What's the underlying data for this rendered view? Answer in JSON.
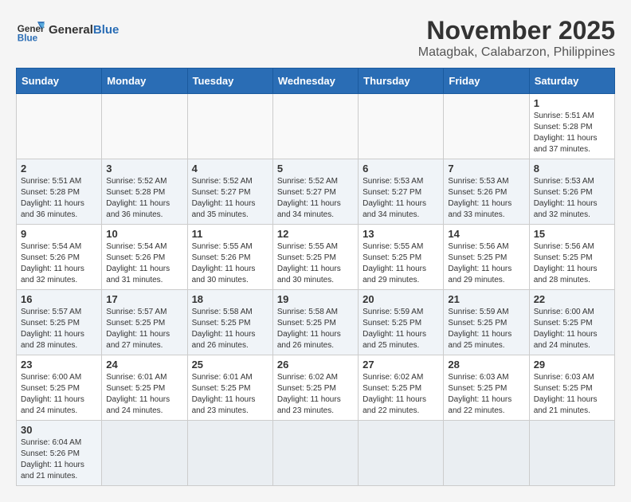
{
  "header": {
    "logo_general": "General",
    "logo_blue": "Blue",
    "month_title": "November 2025",
    "location": "Matagbak, Calabarzon, Philippines"
  },
  "days_of_week": [
    "Sunday",
    "Monday",
    "Tuesday",
    "Wednesday",
    "Thursday",
    "Friday",
    "Saturday"
  ],
  "weeks": [
    [
      {
        "day": "",
        "info": ""
      },
      {
        "day": "",
        "info": ""
      },
      {
        "day": "",
        "info": ""
      },
      {
        "day": "",
        "info": ""
      },
      {
        "day": "",
        "info": ""
      },
      {
        "day": "",
        "info": ""
      },
      {
        "day": "1",
        "info": "Sunrise: 5:51 AM\nSunset: 5:28 PM\nDaylight: 11 hours\nand 37 minutes."
      }
    ],
    [
      {
        "day": "2",
        "info": "Sunrise: 5:51 AM\nSunset: 5:28 PM\nDaylight: 11 hours\nand 36 minutes."
      },
      {
        "day": "3",
        "info": "Sunrise: 5:52 AM\nSunset: 5:28 PM\nDaylight: 11 hours\nand 36 minutes."
      },
      {
        "day": "4",
        "info": "Sunrise: 5:52 AM\nSunset: 5:27 PM\nDaylight: 11 hours\nand 35 minutes."
      },
      {
        "day": "5",
        "info": "Sunrise: 5:52 AM\nSunset: 5:27 PM\nDaylight: 11 hours\nand 34 minutes."
      },
      {
        "day": "6",
        "info": "Sunrise: 5:53 AM\nSunset: 5:27 PM\nDaylight: 11 hours\nand 34 minutes."
      },
      {
        "day": "7",
        "info": "Sunrise: 5:53 AM\nSunset: 5:26 PM\nDaylight: 11 hours\nand 33 minutes."
      },
      {
        "day": "8",
        "info": "Sunrise: 5:53 AM\nSunset: 5:26 PM\nDaylight: 11 hours\nand 32 minutes."
      }
    ],
    [
      {
        "day": "9",
        "info": "Sunrise: 5:54 AM\nSunset: 5:26 PM\nDaylight: 11 hours\nand 32 minutes."
      },
      {
        "day": "10",
        "info": "Sunrise: 5:54 AM\nSunset: 5:26 PM\nDaylight: 11 hours\nand 31 minutes."
      },
      {
        "day": "11",
        "info": "Sunrise: 5:55 AM\nSunset: 5:26 PM\nDaylight: 11 hours\nand 30 minutes."
      },
      {
        "day": "12",
        "info": "Sunrise: 5:55 AM\nSunset: 5:25 PM\nDaylight: 11 hours\nand 30 minutes."
      },
      {
        "day": "13",
        "info": "Sunrise: 5:55 AM\nSunset: 5:25 PM\nDaylight: 11 hours\nand 29 minutes."
      },
      {
        "day": "14",
        "info": "Sunrise: 5:56 AM\nSunset: 5:25 PM\nDaylight: 11 hours\nand 29 minutes."
      },
      {
        "day": "15",
        "info": "Sunrise: 5:56 AM\nSunset: 5:25 PM\nDaylight: 11 hours\nand 28 minutes."
      }
    ],
    [
      {
        "day": "16",
        "info": "Sunrise: 5:57 AM\nSunset: 5:25 PM\nDaylight: 11 hours\nand 28 minutes."
      },
      {
        "day": "17",
        "info": "Sunrise: 5:57 AM\nSunset: 5:25 PM\nDaylight: 11 hours\nand 27 minutes."
      },
      {
        "day": "18",
        "info": "Sunrise: 5:58 AM\nSunset: 5:25 PM\nDaylight: 11 hours\nand 26 minutes."
      },
      {
        "day": "19",
        "info": "Sunrise: 5:58 AM\nSunset: 5:25 PM\nDaylight: 11 hours\nand 26 minutes."
      },
      {
        "day": "20",
        "info": "Sunrise: 5:59 AM\nSunset: 5:25 PM\nDaylight: 11 hours\nand 25 minutes."
      },
      {
        "day": "21",
        "info": "Sunrise: 5:59 AM\nSunset: 5:25 PM\nDaylight: 11 hours\nand 25 minutes."
      },
      {
        "day": "22",
        "info": "Sunrise: 6:00 AM\nSunset: 5:25 PM\nDaylight: 11 hours\nand 24 minutes."
      }
    ],
    [
      {
        "day": "23",
        "info": "Sunrise: 6:00 AM\nSunset: 5:25 PM\nDaylight: 11 hours\nand 24 minutes."
      },
      {
        "day": "24",
        "info": "Sunrise: 6:01 AM\nSunset: 5:25 PM\nDaylight: 11 hours\nand 24 minutes."
      },
      {
        "day": "25",
        "info": "Sunrise: 6:01 AM\nSunset: 5:25 PM\nDaylight: 11 hours\nand 23 minutes."
      },
      {
        "day": "26",
        "info": "Sunrise: 6:02 AM\nSunset: 5:25 PM\nDaylight: 11 hours\nand 23 minutes."
      },
      {
        "day": "27",
        "info": "Sunrise: 6:02 AM\nSunset: 5:25 PM\nDaylight: 11 hours\nand 22 minutes."
      },
      {
        "day": "28",
        "info": "Sunrise: 6:03 AM\nSunset: 5:25 PM\nDaylight: 11 hours\nand 22 minutes."
      },
      {
        "day": "29",
        "info": "Sunrise: 6:03 AM\nSunset: 5:25 PM\nDaylight: 11 hours\nand 21 minutes."
      }
    ],
    [
      {
        "day": "30",
        "info": "Sunrise: 6:04 AM\nSunset: 5:26 PM\nDaylight: 11 hours\nand 21 minutes."
      },
      {
        "day": "",
        "info": ""
      },
      {
        "day": "",
        "info": ""
      },
      {
        "day": "",
        "info": ""
      },
      {
        "day": "",
        "info": ""
      },
      {
        "day": "",
        "info": ""
      },
      {
        "day": "",
        "info": ""
      }
    ]
  ]
}
